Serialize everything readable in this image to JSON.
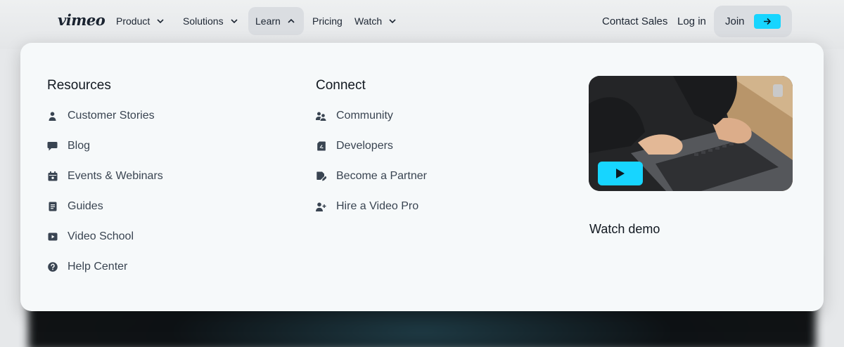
{
  "nav": {
    "logo": "vimeo",
    "items": [
      {
        "label": "Product",
        "has_dropdown": true,
        "open": false
      },
      {
        "label": "Solutions",
        "has_dropdown": true,
        "open": false
      },
      {
        "label": "Learn",
        "has_dropdown": true,
        "open": true
      },
      {
        "label": "Pricing",
        "has_dropdown": false
      },
      {
        "label": "Watch",
        "has_dropdown": true,
        "open": false
      }
    ],
    "contact_sales": "Contact Sales",
    "login": "Log in",
    "join": "Join"
  },
  "menu": {
    "resources": {
      "title": "Resources",
      "links": [
        {
          "label": "Customer Stories",
          "icon": "person-icon"
        },
        {
          "label": "Blog",
          "icon": "speech-bubble-icon"
        },
        {
          "label": "Events & Webinars",
          "icon": "calendar-icon"
        },
        {
          "label": "Guides",
          "icon": "document-icon"
        },
        {
          "label": "Video School",
          "icon": "video-play-icon"
        },
        {
          "label": "Help Center",
          "icon": "help-question-icon"
        }
      ]
    },
    "connect": {
      "title": "Connect",
      "links": [
        {
          "label": "Community",
          "icon": "group-icon"
        },
        {
          "label": "Developers",
          "icon": "developer-file-icon"
        },
        {
          "label": "Become a Partner",
          "icon": "partner-edit-icon"
        },
        {
          "label": "Hire a Video Pro",
          "icon": "add-person-icon"
        }
      ]
    },
    "demo": {
      "label": "Watch demo"
    }
  },
  "colors": {
    "accent": "#17d5ff",
    "text_dark": "#111820",
    "text_link": "#394451",
    "panel_bg": "#f6f9fa"
  }
}
